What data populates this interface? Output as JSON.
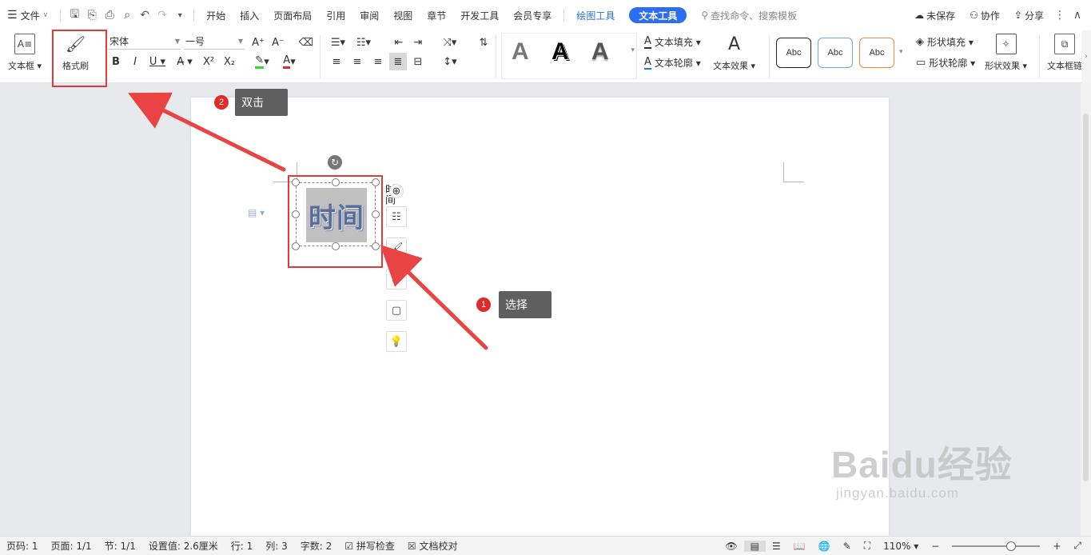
{
  "menubar": {
    "file_label": "文件",
    "tabs": [
      "开始",
      "插入",
      "页面布局",
      "引用",
      "审阅",
      "视图",
      "章节",
      "开发工具",
      "会员专享"
    ],
    "drawing_tools": "绘图工具",
    "text_tools": "文本工具",
    "search_placeholder": "查找命令、搜索模板",
    "unsaved": "未保存",
    "collaborate": "协作",
    "share": "分享"
  },
  "ribbon": {
    "textbox_label": "文本框",
    "format_painter_label": "格式刷",
    "font_name": "宋体",
    "font_size": "一号",
    "text_fill": "文本填充",
    "text_outline": "文本轮廓",
    "text_effect": "文本效果",
    "style_glyph": "A",
    "abc_label": "Abc",
    "shape_fill": "形状填充",
    "shape_outline": "形状轮廓",
    "shape_effect": "形状效果",
    "textbox_link": "文本框链"
  },
  "document": {
    "textbox_text": "时间",
    "side_text": "时间"
  },
  "annotations": {
    "step1_num": "1",
    "step1_label": "选择",
    "step2_num": "2",
    "step2_label": "双击"
  },
  "statusbar": {
    "page": "页码: 1",
    "pages": "页面: 1/1",
    "section": "节: 1/1",
    "setting": "设置值: 2.6厘米",
    "row": "行: 1",
    "col": "列: 3",
    "words": "字数: 2",
    "spellcheck": "拼写检查",
    "doc_check": "文档校对",
    "zoom": "110%"
  },
  "watermark": {
    "brand": "Baidu经验",
    "url": "jingyan.baidu.com"
  },
  "colors": {
    "accent": "#2c6ef2",
    "annotation_red": "#e03b3b"
  }
}
